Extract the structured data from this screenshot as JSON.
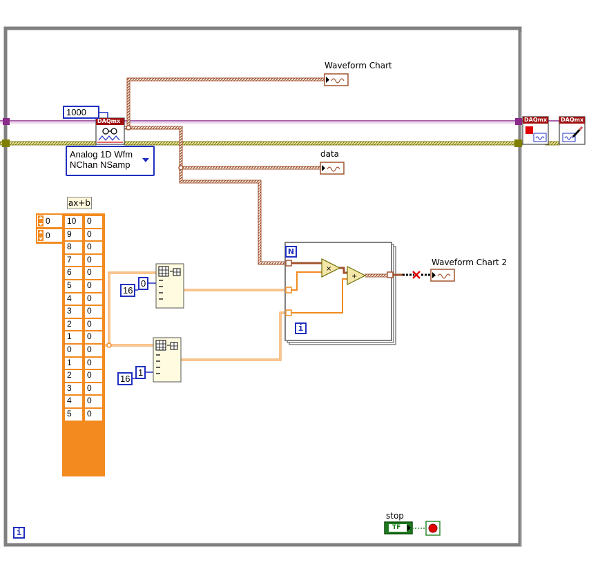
{
  "constants": {
    "samples": "1000",
    "index_a": "0",
    "index_b": "1",
    "length_a": "16",
    "length_b": "16"
  },
  "daqmx_read": {
    "badge": "DAQmx",
    "mode_line1": "Analog 1D Wfm",
    "mode_line2": "NChan NSamp"
  },
  "daqmx_stop": {
    "badge": "DAQmx"
  },
  "daqmx_clear": {
    "badge": "DAQmx"
  },
  "labels": {
    "waveform_chart": "Waveform Chart",
    "data": "data",
    "waveform_chart_2": "Waveform Chart 2",
    "axb": "ax+b",
    "stop": "stop",
    "for_count": "N",
    "for_iter": "i",
    "while_iter": "i",
    "bool_tf": "TF"
  },
  "array_indices": [
    "0",
    "0"
  ],
  "array_rows": [
    [
      "10",
      "0"
    ],
    [
      "9",
      "0"
    ],
    [
      "8",
      "0"
    ],
    [
      "7",
      "0"
    ],
    [
      "6",
      "0"
    ],
    [
      "5",
      "0"
    ],
    [
      "4",
      "0"
    ],
    [
      "3",
      "0"
    ],
    [
      "2",
      "0"
    ],
    [
      "1",
      "0"
    ],
    [
      "0",
      "0"
    ],
    [
      "1",
      "0"
    ],
    [
      "2",
      "0"
    ],
    [
      "3",
      "0"
    ],
    [
      "4",
      "0"
    ],
    [
      "5",
      "0"
    ]
  ],
  "colors": {
    "frame": "#808080",
    "task_wire": "#8a2a8a",
    "error_wire": "#8f8f00",
    "waveform_wire": "#a0522d",
    "numeric_wire": "#f28a1f",
    "constant_border": "#1f2fbf",
    "boolean_wire": "#2e8b2e",
    "stop_red": "#e00000"
  },
  "icons": [
    "daqmx-read-icon",
    "daqmx-stop-icon",
    "daqmx-clear-icon",
    "array-subset-icon",
    "multiply-icon",
    "add-icon",
    "coercion-icon",
    "stop-terminal-icon"
  ]
}
